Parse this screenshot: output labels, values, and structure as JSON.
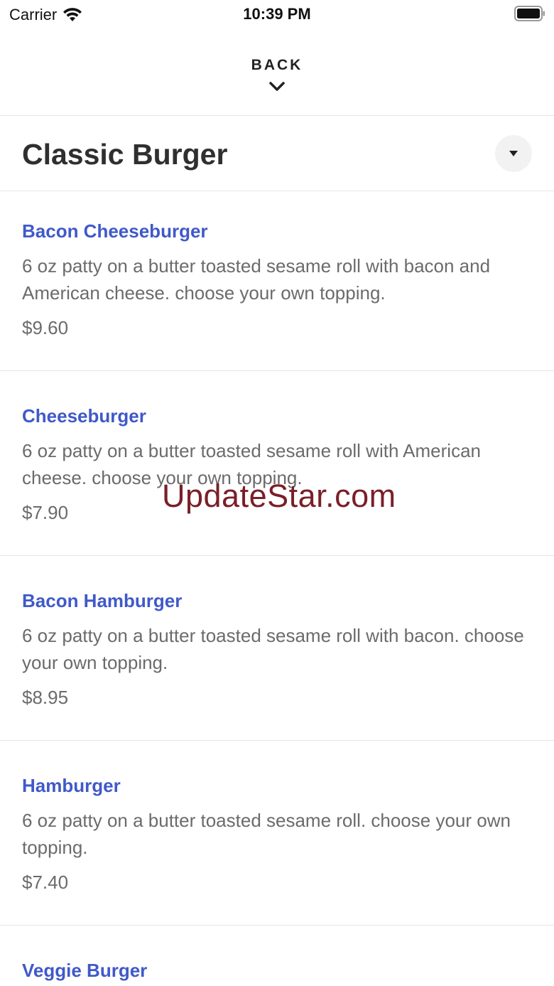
{
  "status": {
    "carrier": "Carrier",
    "time": "10:39 PM"
  },
  "nav": {
    "back_label": "BACK"
  },
  "category": {
    "title": "Classic Burger"
  },
  "items": [
    {
      "name": "Bacon Cheeseburger",
      "description": "6 oz patty on a butter toasted sesame roll with bacon and American cheese. choose your own topping.",
      "price": "$9.60"
    },
    {
      "name": "Cheeseburger",
      "description": "6 oz patty on a butter toasted sesame roll with American cheese. choose your own topping.",
      "price": "$7.90"
    },
    {
      "name": "Bacon Hamburger",
      "description": "6 oz patty on a butter toasted sesame roll with bacon. choose your own topping.",
      "price": "$8.95"
    },
    {
      "name": "Hamburger",
      "description": "6 oz patty on a butter toasted sesame roll. choose your own topping.",
      "price": "$7.40"
    },
    {
      "name": "Veggie Burger"
    }
  ],
  "watermark": "UpdateStar.com",
  "colors": {
    "item_name": "#4059c9",
    "text_muted": "#6b6b6b",
    "divider": "#e6e6e6"
  }
}
